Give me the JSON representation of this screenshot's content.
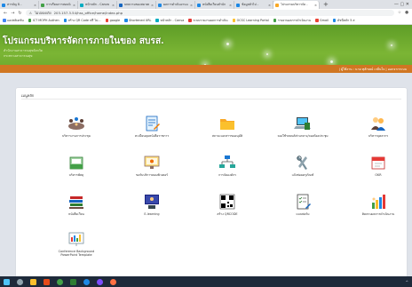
{
  "browser": {
    "tabs": [
      {
        "label": "สารบัญ นิ - ",
        "color": "#1e88e5",
        "active": false
      },
      {
        "label": "การเรียนการสอนนิ - ",
        "color": "#43a047",
        "active": false
      },
      {
        "label": "หน้าหลัก - Canva",
        "color": "#00acc1",
        "active": false
      },
      {
        "label": "บทความของสมาคม -",
        "color": "#1565c0",
        "active": false
      },
      {
        "label": "ผลการดำเนินงานและ",
        "color": "#1e88e5",
        "active": false
      },
      {
        "label": "หนังสือเวียนสำนัก",
        "color": "#1e88e5",
        "active": false
      },
      {
        "label": "ข้อมูลทั่วไป -",
        "color": "#1e88e5",
        "active": false
      },
      {
        "label": "โปรแกรมบริหารจัด -",
        "color": "#f9a825",
        "active": true
      }
    ],
    "new_tab": "+",
    "window_controls": "— ▢ ✕",
    "url": "203.157.3.54/hss_office/home/index.php",
    "security_label": "ไม่ปลอดภัย",
    "bookmarks": [
      {
        "label": "แอปพลิเคชัน",
        "color": "#4285f4"
      },
      {
        "label": "ICT MOPH Authen",
        "color": "#43a047"
      },
      {
        "label": "สร้าง QR Code ฟรี ไม่...",
        "color": "#1e88e5"
      },
      {
        "label": "google",
        "color": "#ea4335"
      },
      {
        "label": "Shortened URL",
        "color": "#1e88e5"
      },
      {
        "label": "หน้าหลัก - Canva",
        "color": "#00acc1"
      },
      {
        "label": "ระบบรายงานผลการดำเนิน",
        "color": "#e53935"
      },
      {
        "label": "OCSC Learning Portal",
        "color": "#fbc02d"
      },
      {
        "label": "รายงานผลการดำเนินงาน",
        "color": "#43a047"
      },
      {
        "label": "Gmail",
        "color": "#ea4335"
      },
      {
        "label": "ดัชนีหลัก 5 ส",
        "color": "#1e88e5"
      }
    ]
  },
  "site": {
    "title": "โปรแกรมบริหารจัดการภายในของ สบรส.",
    "subtitle1": "สำนักงานสาธารณสุขจังหวัด",
    "subtitle2": "กระทรวงสาธารณสุข",
    "user_info": "| ผู้ใช้งาน : นาย ทุลักษณ์ เกลิ่นใจ | ออกจากระบบ"
  },
  "menu": {
    "title": "เมนูหลัก",
    "items": [
      {
        "label": "บริหารงานการประชุม",
        "icon": "meeting-icon"
      },
      {
        "label": "ทะเบียนคุมหนังสือราชการ",
        "icon": "document-edit-icon"
      },
      {
        "label": "สถานะเอกสารขออนุมัติ",
        "icon": "folder-icon"
      },
      {
        "label": "จองใช้รถยนต์ส่วนกลาง/จองห้องประชุม",
        "icon": "computer-book-icon"
      },
      {
        "label": "บริหารบุคลากร",
        "icon": "people-icon"
      },
      {
        "label": "บริหารพัสดุ",
        "icon": "inventory-icon"
      },
      {
        "label": "ขอรับบริการคอมพิวเตอร์",
        "icon": "monitor-icon"
      },
      {
        "label": "การจัดองค์กร",
        "icon": "org-chart-icon"
      },
      {
        "label": "แจ้งซ่อมครุภัณฑ์",
        "icon": "tools-icon"
      },
      {
        "label": "OKR",
        "icon": "calendar-icon"
      },
      {
        "label": "หนังสือเวียน",
        "icon": "books-icon"
      },
      {
        "label": "E-learning",
        "icon": "elearning-icon"
      },
      {
        "label": "สร้าง QRCODE",
        "icon": "qrcode-icon"
      },
      {
        "label": "แบบฟอร์ม",
        "icon": "form-icon"
      },
      {
        "label": "ติดตามผลการดำเนินงาน",
        "icon": "bar-chart-icon"
      },
      {
        "label": "Conference Background PowerPoint Template",
        "icon": "template-icon"
      }
    ]
  },
  "taskbar": {
    "tray": "^ ",
    "icons": [
      "windows-icon",
      "search-icon",
      "explorer-icon",
      "powerpoint-icon",
      "chrome-icon",
      "excel-icon",
      "edge-icon",
      "messenger-icon",
      "firefox-icon"
    ]
  }
}
